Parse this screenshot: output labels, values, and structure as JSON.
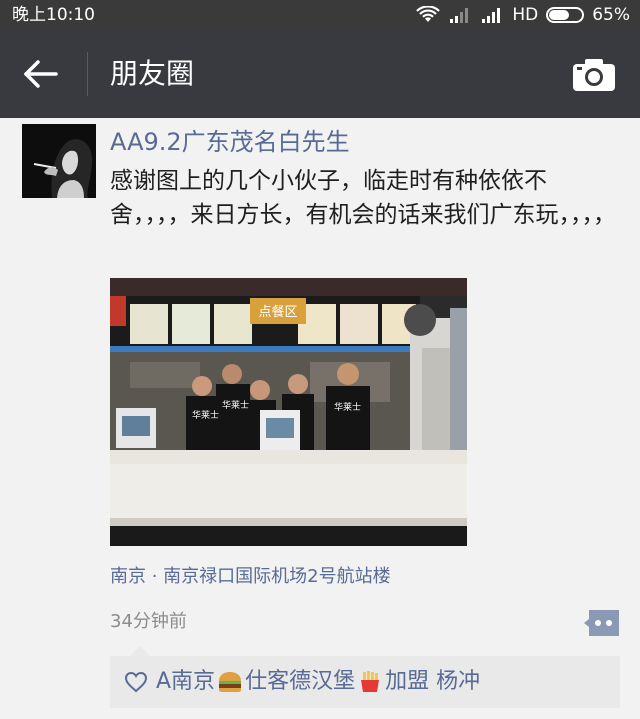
{
  "status_bar": {
    "time": "晚上10:10",
    "network": "HD",
    "battery": "65%",
    "battery_level": 0.65
  },
  "nav": {
    "title": "朋友圈"
  },
  "post": {
    "username": "AA9.2广东茂名白先生",
    "text": "感谢图上的几个小伙子，临走时有种依依不舍，，，，来日方长，有机会的话来我们广东玩，，，，",
    "photo_sign": "点餐区",
    "photo_shirt_text": "华莱士",
    "location": "南京 · 南京禄口国际机场2号航站楼",
    "time_ago": "34分钟前",
    "likes": {
      "liker_part1": "A南京",
      "liker_part2": "仕客德汉堡",
      "liker_part3": "加盟 杨冲"
    }
  },
  "colors": {
    "status_bar_bg": "#3a3a3a",
    "nav_bg": "#393a3f",
    "link": "#576b95",
    "page_bg": "#f2f2f2"
  },
  "icons": {
    "back": "arrow-left-icon",
    "camera": "camera-icon",
    "comment": "comment-dots-icon",
    "heart": "heart-outline-icon",
    "wifi": "wifi-icon",
    "signal": "signal-icon"
  }
}
